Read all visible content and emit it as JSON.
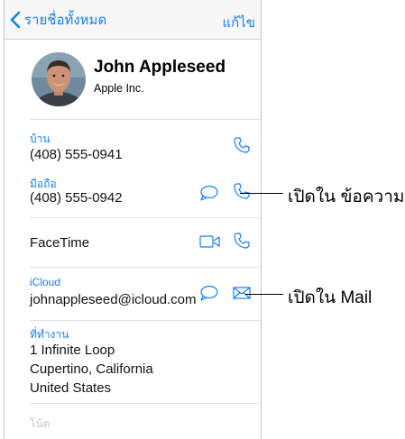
{
  "nav": {
    "back_label": "รายชื่อทั้งหมด",
    "edit_label": "แก้ไข"
  },
  "contact": {
    "name": "John Appleseed",
    "company": "Apple Inc."
  },
  "fields": {
    "home": {
      "label": "บ้าน",
      "value": "(408) 555-0941"
    },
    "mobile": {
      "label": "มือถือ",
      "value": "(408) 555-0942"
    },
    "facetime": {
      "label": "FaceTime"
    },
    "icloud": {
      "label": "iCloud",
      "value": "johnappleseed@icloud.com"
    },
    "work": {
      "label": "ที่ทำงาน",
      "line1": "1 Infinite Loop",
      "line2": "Cupertino, California",
      "line3": "United States"
    },
    "notes": {
      "label": "โน้ต"
    }
  },
  "callouts": {
    "messages": "เปิดใน ข้อความ",
    "mail": "เปิดใน Mail"
  },
  "colors": {
    "accent": "#157efb"
  },
  "icons": [
    "chevron-left-icon",
    "phone-icon",
    "message-icon",
    "video-icon",
    "mail-icon"
  ]
}
